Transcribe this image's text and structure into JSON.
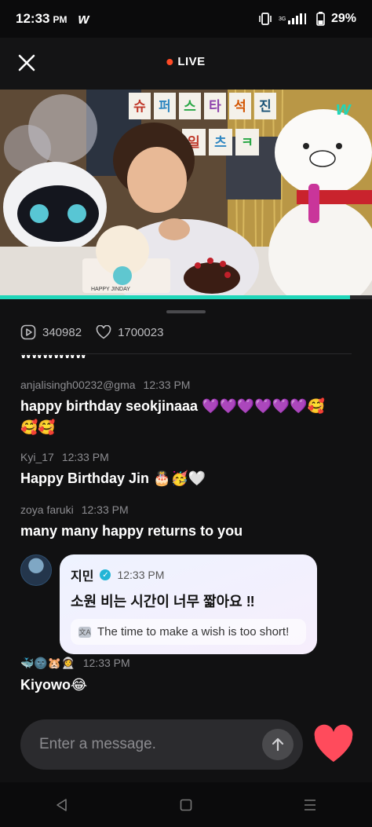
{
  "status_bar": {
    "time": "12:33",
    "ampm": "PM",
    "app_logo": "w",
    "battery": "29%",
    "icons": [
      "vibrate-icon",
      "signal-icon",
      "battery-icon"
    ]
  },
  "header": {
    "live_label": "LIVE",
    "live_color": "#ff4b26"
  },
  "video": {
    "signs_line1": [
      "슈",
      "퍼",
      "스",
      "타",
      "석",
      "진"
    ],
    "signs_line2": [
      "일",
      "츠",
      "ㅋ"
    ],
    "watermark": "w",
    "cake_label": "HAPPY JINDAY",
    "progress": 0.94,
    "accent": "#20d6b9"
  },
  "stats": {
    "plays": "340982",
    "likes": "1700023"
  },
  "chat": {
    "messages": [
      {
        "user": "anjalisingh00232@gma",
        "time": "12:33 PM",
        "text": "happy birthday seokjinaaa",
        "emoji_line1": "💜💜💜💜💜💜🥰",
        "emoji_line2": "🥰🥰"
      },
      {
        "user": "Kyi_17",
        "time": "12:33 PM",
        "text": "Happy Birthday Jin 🎂🥳🤍"
      },
      {
        "user": "zoya faruki",
        "time": "12:33 PM",
        "text": "many many happy returns to you"
      },
      {
        "user": "🐳🌚🐹👩‍🚀",
        "time": "12:33 PM",
        "text": "Kiyowo😂"
      }
    ],
    "artist": {
      "name": "지민",
      "time": "12:33 PM",
      "text": "소원 비는 시간이 너무 짧아요 ‼",
      "translation": "The time to make a wish is too short!"
    }
  },
  "input": {
    "placeholder": "Enter a message."
  },
  "colors": {
    "like": "#ff4b5c",
    "background": "#111112"
  }
}
